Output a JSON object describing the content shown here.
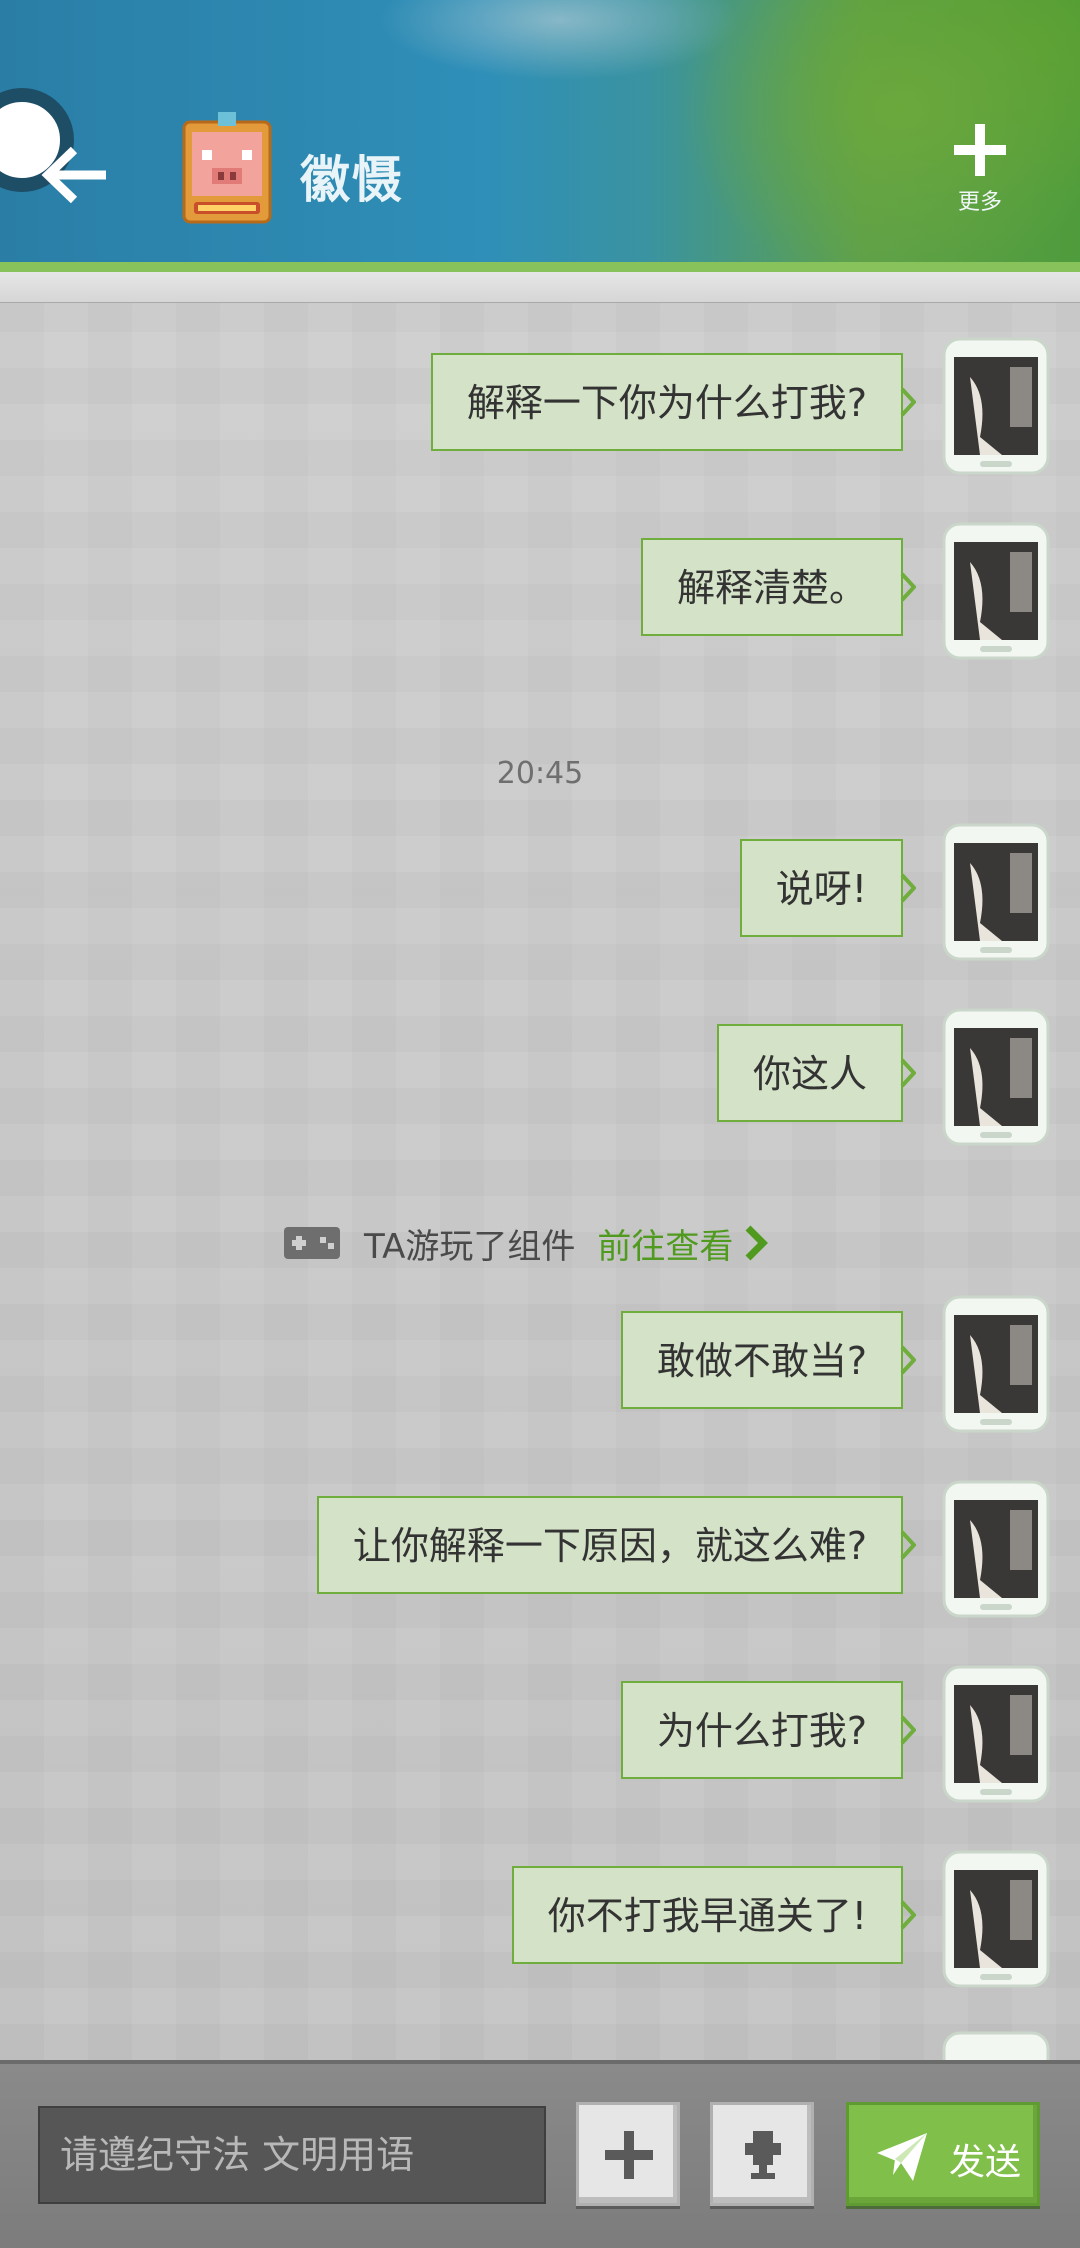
{
  "header": {
    "contact_name": "徽慑",
    "more_label": "更多",
    "accent": "#88c25a"
  },
  "messages": [
    {
      "text": "解释一下你为什么打我?"
    },
    {
      "text": "解释清楚。"
    },
    {
      "text": "说呀!"
    },
    {
      "text": "你这人"
    },
    {
      "text": "敢做不敢当?"
    },
    {
      "text": "让你解释一下原因，就这么难?"
    },
    {
      "text": "为什么打我?"
    },
    {
      "text": "你不打我早通关了!"
    }
  ],
  "timestamp": "20:45",
  "notice": {
    "text": "TA游玩了组件",
    "link": "前往查看"
  },
  "input": {
    "placeholder": "请遵纪守法 文明用语"
  },
  "send_label": "发送",
  "colors": {
    "bubble_bg": "#d4e2c7",
    "bubble_border": "#6fae3c",
    "link": "#4f9a1f",
    "send_button": "#7fbf4a"
  }
}
